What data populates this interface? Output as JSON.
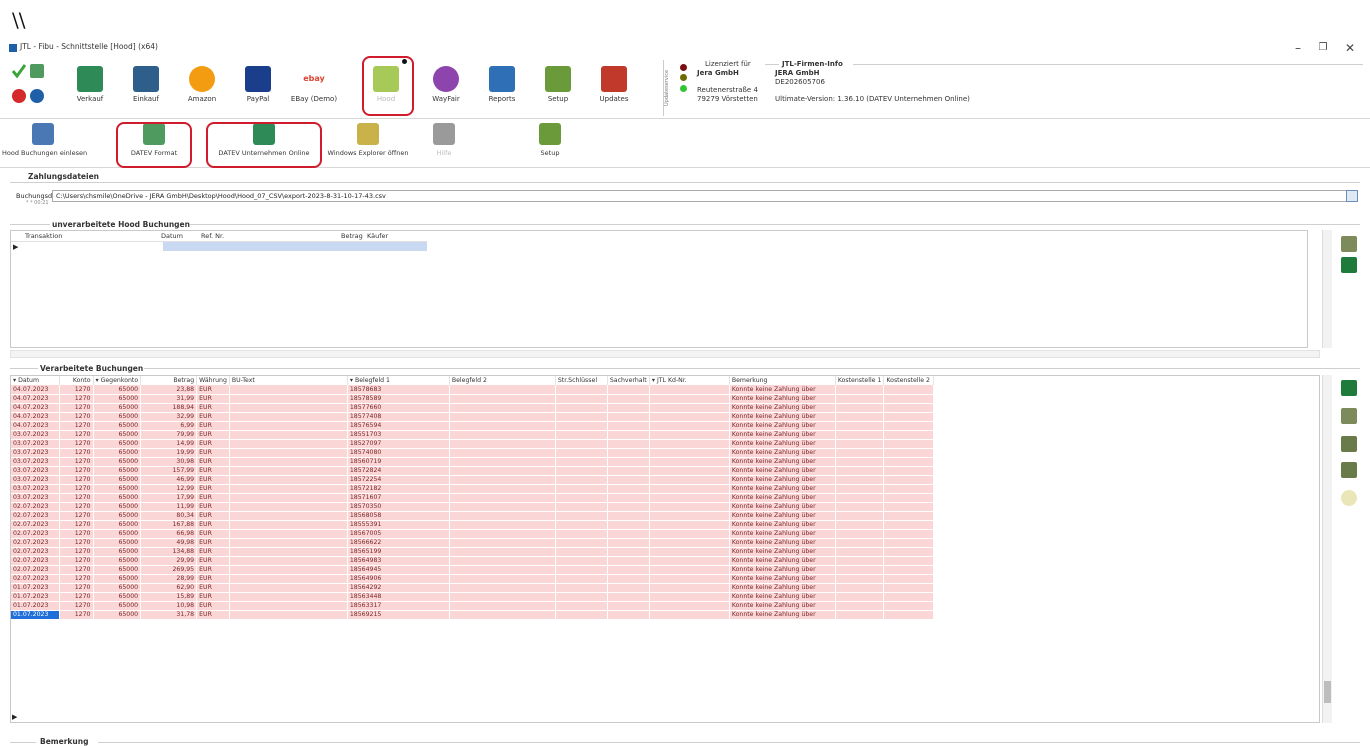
{
  "annotation_text": "\\\\",
  "window": {
    "title": "JTL - Fibu - Schnittstelle [Hood] (x64)",
    "min": "–",
    "max": "❐",
    "close": "✕"
  },
  "ribbon": [
    {
      "label": "Verkauf",
      "color": "#2e8b57"
    },
    {
      "label": "Einkauf",
      "color": "#2d5f8a"
    },
    {
      "label": "Amazon",
      "color": "#f39c12"
    },
    {
      "label": "PayPal",
      "color": "#1a3e8c"
    },
    {
      "label": "EBay (Demo)",
      "color": "#d9d9d9"
    },
    {
      "label": "Hood",
      "color": "#a7c957"
    },
    {
      "label": "WayFair",
      "color": "#8e44ad"
    },
    {
      "label": "Reports",
      "color": "#2f6fb5"
    },
    {
      "label": "Setup",
      "color": "#6a9a3a"
    },
    {
      "label": "Updates",
      "color": "#c0392b"
    }
  ],
  "ebay_logo": "ebay",
  "license": {
    "vertical": "Updateservice",
    "licensed_for_label": "Lizenziert für",
    "licensee": "Jera GmbH",
    "street": "Reutenerstraße 4",
    "city": "79279 Vörstetten",
    "info_label": "JTL-Firmen-Info",
    "company": "JERA GmbH",
    "code": "DE202605706",
    "version": "Ultimate-Version: 1.36.10 (DATEV Unternehmen Online)"
  },
  "sub_toolbar": [
    {
      "label": "Hood Buchungen einlesen"
    },
    {
      "label": "DATEV Format"
    },
    {
      "label": "DATEV Unternehmen Online"
    },
    {
      "label": "Windows Explorer öffnen"
    },
    {
      "label": "Hilfe"
    },
    {
      "label": "Setup"
    }
  ],
  "zahlungsdateien": {
    "title": "Zahlungsdateien",
    "path_label": "Buchungsdatei",
    "path_hint": "* * 00:21",
    "path": "C:\\Users\\chsmile\\OneDrive - JERA GmbH\\Desktop\\Hood\\Hood_07_CSV\\export-2023-8-31-10-17-43.csv"
  },
  "unprocessed": {
    "title": "unverarbeitete Hood Buchungen",
    "headers": [
      "Transaktion",
      "Datum",
      "Ref. Nr.",
      "Betrag",
      "Käufer"
    ]
  },
  "processed": {
    "title": "Verarbeitete Buchungen",
    "headers": [
      "▾ Datum",
      "Konto",
      "▾ Gegenkonto",
      "Betrag",
      "Währung",
      "BU-Text",
      "▾ Belegfeld 1",
      "Belegfeld 2",
      "Str.Schlüssel",
      "Sachverhalt",
      "▾ JTL Kd-Nr.",
      "Bemerkung",
      "Kostenstelle 1",
      "Kostenstelle 2"
    ],
    "rows": [
      [
        "04.07.2023",
        "1270",
        "65000",
        "23,88",
        "EUR",
        "",
        "18578683",
        "",
        "",
        "",
        "",
        "Konnte keine Zahlung über",
        "",
        ""
      ],
      [
        "04.07.2023",
        "1270",
        "65000",
        "31,99",
        "EUR",
        "",
        "18578589",
        "",
        "",
        "",
        "",
        "Konnte keine Zahlung über",
        "",
        ""
      ],
      [
        "04.07.2023",
        "1270",
        "65000",
        "188,94",
        "EUR",
        "",
        "18577660",
        "",
        "",
        "",
        "",
        "Konnte keine Zahlung über",
        "",
        ""
      ],
      [
        "04.07.2023",
        "1270",
        "65000",
        "32,99",
        "EUR",
        "",
        "18577408",
        "",
        "",
        "",
        "",
        "Konnte keine Zahlung über",
        "",
        ""
      ],
      [
        "04.07.2023",
        "1270",
        "65000",
        "6,99",
        "EUR",
        "",
        "18576594",
        "",
        "",
        "",
        "",
        "Konnte keine Zahlung über",
        "",
        ""
      ],
      [
        "03.07.2023",
        "1270",
        "65000",
        "79,99",
        "EUR",
        "",
        "18551703",
        "",
        "",
        "",
        "",
        "Konnte keine Zahlung über",
        "",
        ""
      ],
      [
        "03.07.2023",
        "1270",
        "65000",
        "14,99",
        "EUR",
        "",
        "18527097",
        "",
        "",
        "",
        "",
        "Konnte keine Zahlung über",
        "",
        ""
      ],
      [
        "03.07.2023",
        "1270",
        "65000",
        "19,99",
        "EUR",
        "",
        "18574080",
        "",
        "",
        "",
        "",
        "Konnte keine Zahlung über",
        "",
        ""
      ],
      [
        "03.07.2023",
        "1270",
        "65000",
        "30,98",
        "EUR",
        "",
        "18560719",
        "",
        "",
        "",
        "",
        "Konnte keine Zahlung über",
        "",
        ""
      ],
      [
        "03.07.2023",
        "1270",
        "65000",
        "157,99",
        "EUR",
        "",
        "18572824",
        "",
        "",
        "",
        "",
        "Konnte keine Zahlung über",
        "",
        ""
      ],
      [
        "03.07.2023",
        "1270",
        "65000",
        "46,99",
        "EUR",
        "",
        "18572254",
        "",
        "",
        "",
        "",
        "Konnte keine Zahlung über",
        "",
        ""
      ],
      [
        "03.07.2023",
        "1270",
        "65000",
        "12,99",
        "EUR",
        "",
        "18572182",
        "",
        "",
        "",
        "",
        "Konnte keine Zahlung über",
        "",
        ""
      ],
      [
        "03.07.2023",
        "1270",
        "65000",
        "17,99",
        "EUR",
        "",
        "18571607",
        "",
        "",
        "",
        "",
        "Konnte keine Zahlung über",
        "",
        ""
      ],
      [
        "02.07.2023",
        "1270",
        "65000",
        "11,99",
        "EUR",
        "",
        "18570350",
        "",
        "",
        "",
        "",
        "Konnte keine Zahlung über",
        "",
        ""
      ],
      [
        "02.07.2023",
        "1270",
        "65000",
        "80,34",
        "EUR",
        "",
        "18568058",
        "",
        "",
        "",
        "",
        "Konnte keine Zahlung über",
        "",
        ""
      ],
      [
        "02.07.2023",
        "1270",
        "65000",
        "167,88",
        "EUR",
        "",
        "18555391",
        "",
        "",
        "",
        "",
        "Konnte keine Zahlung über",
        "",
        ""
      ],
      [
        "02.07.2023",
        "1270",
        "65000",
        "66,98",
        "EUR",
        "",
        "18567005",
        "",
        "",
        "",
        "",
        "Konnte keine Zahlung über",
        "",
        ""
      ],
      [
        "02.07.2023",
        "1270",
        "65000",
        "49,98",
        "EUR",
        "",
        "18566622",
        "",
        "",
        "",
        "",
        "Konnte keine Zahlung über",
        "",
        ""
      ],
      [
        "02.07.2023",
        "1270",
        "65000",
        "134,88",
        "EUR",
        "",
        "18565199",
        "",
        "",
        "",
        "",
        "Konnte keine Zahlung über",
        "",
        ""
      ],
      [
        "02.07.2023",
        "1270",
        "65000",
        "29,99",
        "EUR",
        "",
        "18564983",
        "",
        "",
        "",
        "",
        "Konnte keine Zahlung über",
        "",
        ""
      ],
      [
        "02.07.2023",
        "1270",
        "65000",
        "269,95",
        "EUR",
        "",
        "18564945",
        "",
        "",
        "",
        "",
        "Konnte keine Zahlung über",
        "",
        ""
      ],
      [
        "02.07.2023",
        "1270",
        "65000",
        "28,99",
        "EUR",
        "",
        "18564906",
        "",
        "",
        "",
        "",
        "Konnte keine Zahlung über",
        "",
        ""
      ],
      [
        "01.07.2023",
        "1270",
        "65000",
        "62,90",
        "EUR",
        "",
        "18564292",
        "",
        "",
        "",
        "",
        "Konnte keine Zahlung über",
        "",
        ""
      ],
      [
        "01.07.2023",
        "1270",
        "65000",
        "15,89",
        "EUR",
        "",
        "18563448",
        "",
        "",
        "",
        "",
        "Konnte keine Zahlung über",
        "",
        ""
      ],
      [
        "01.07.2023",
        "1270",
        "65000",
        "10,98",
        "EUR",
        "",
        "18563317",
        "",
        "",
        "",
        "",
        "Konnte keine Zahlung über",
        "",
        ""
      ],
      [
        "01.07.2023",
        "1270",
        "65000",
        "31,78",
        "EUR",
        "",
        "18569215",
        "",
        "",
        "",
        "",
        "Konnte keine Zahlung über",
        "",
        ""
      ]
    ]
  },
  "bemerkung": {
    "title": "Bemerkung"
  }
}
